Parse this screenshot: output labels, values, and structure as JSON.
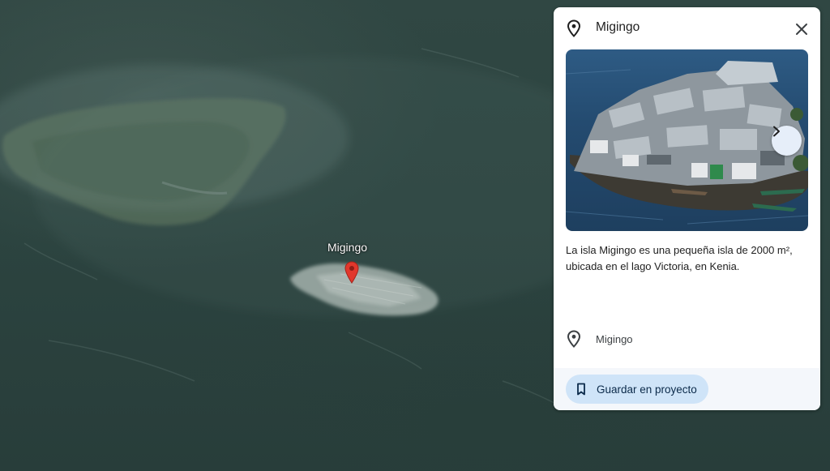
{
  "map": {
    "marker_label": "Migingo",
    "marker_color": "#e2372c"
  },
  "card": {
    "title": "Migingo",
    "description": "La isla Migingo es una pequeña isla de 2000 m², ubicada en el lago Victoria, en Kenia.",
    "address": "Migingo",
    "save_button_label": "Guardar en proyecto",
    "icons": {
      "header": "location-pin-icon",
      "close": "close-icon",
      "next_photo": "chevron-right-icon",
      "address": "location-pin-icon",
      "save": "bookmark-icon"
    }
  },
  "colors": {
    "accent_button": "#cfe4f8",
    "water": "#2f4743"
  }
}
